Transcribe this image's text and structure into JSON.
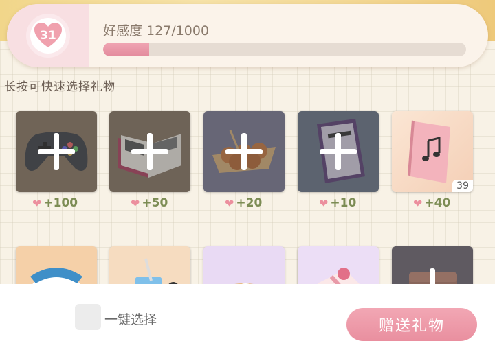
{
  "affinity": {
    "level": "31",
    "label": "好感度 127/1000",
    "progress": 0.127
  },
  "hint": "长按可快速选择礼物",
  "gifts_row1": [
    {
      "name": "game-controller",
      "affinity": "+100",
      "count": "",
      "selectable": true,
      "bg": "#7a6a58"
    },
    {
      "name": "open-book",
      "affinity": "+50",
      "count": "",
      "selectable": true,
      "bg": "#7b6a5a"
    },
    {
      "name": "takoyaki",
      "affinity": "+20",
      "count": "",
      "selectable": true,
      "bg": "#6e6a82"
    },
    {
      "name": "purple-book",
      "affinity": "+10",
      "count": "",
      "selectable": true,
      "bg": "#5e6678"
    },
    {
      "name": "music-notebook",
      "affinity": "+40",
      "count": "39",
      "selectable": false,
      "bg": "#f6d5c0"
    }
  ],
  "gifts_row2": [
    {
      "name": "panda-plush",
      "bg": "#f4cfa8"
    },
    {
      "name": "blue-drink",
      "bg": "#f4d8b8"
    },
    {
      "name": "sushi-platter",
      "bg": "#e6d4f0"
    },
    {
      "name": "gift-box",
      "bg": "#e8d8f2"
    },
    {
      "name": "lunch-box",
      "bg": "#6b6370"
    }
  ],
  "bottom": {
    "select_all_label": "一键选择",
    "send_label": "赠送礼物"
  },
  "colors": {
    "accent_pink": "#e98f9f",
    "affinity_green": "#7c8c54"
  }
}
